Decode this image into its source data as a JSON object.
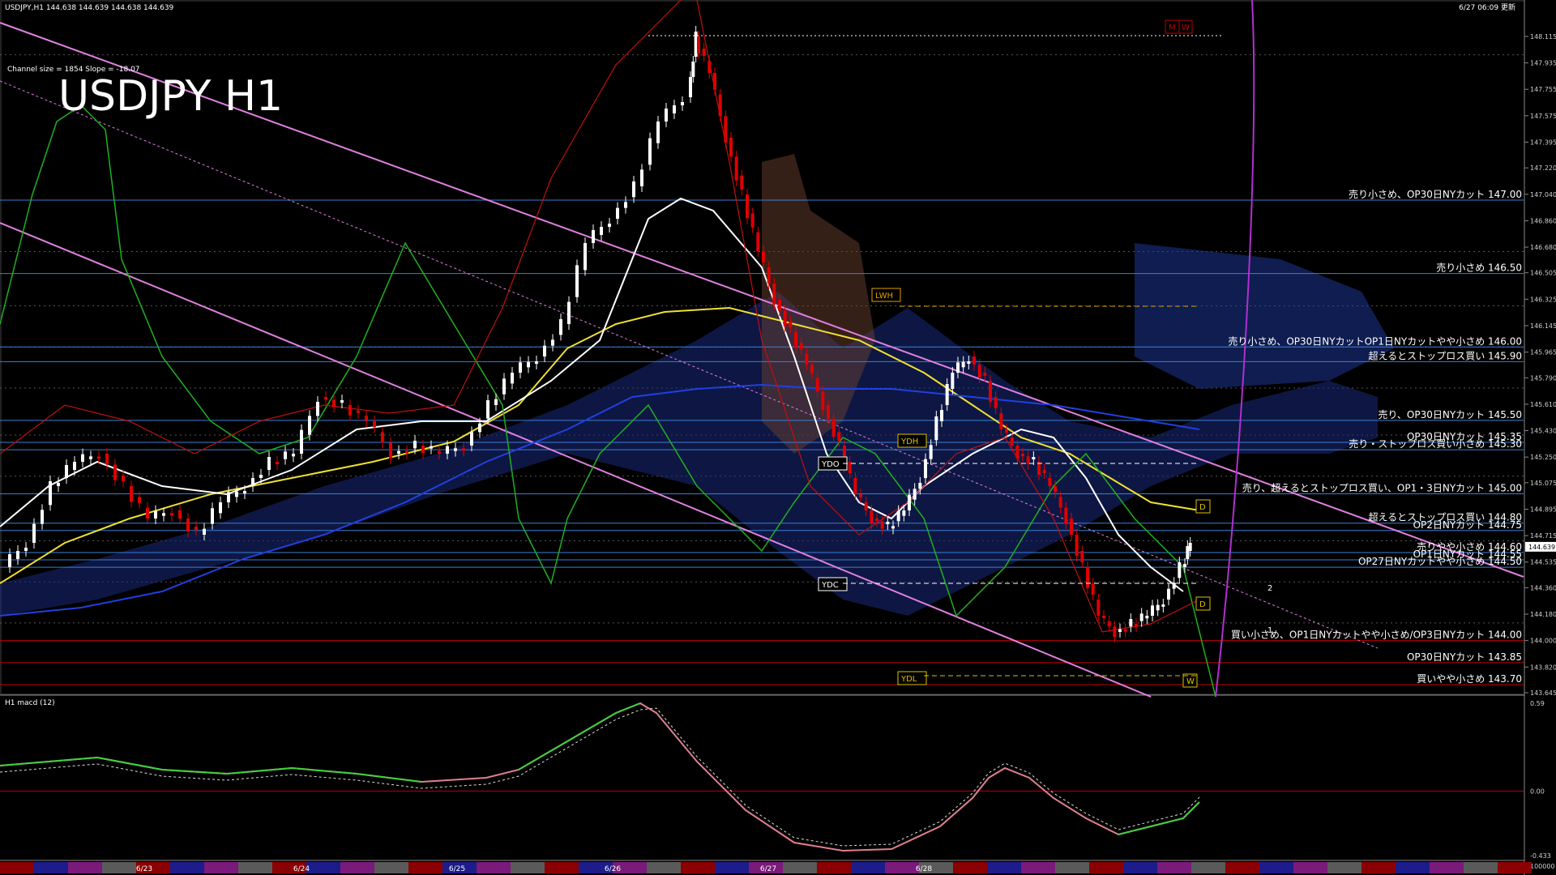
{
  "header": {
    "symbol_info": "USDJPY,H1  144.638 144.639 144.638 144.639",
    "datetime": "6/27 06:09 更新",
    "channel_info": "Channel size = 1854 Slope = -18.07"
  },
  "chart_data": {
    "type": "candlestick",
    "title": "USDJPY H1",
    "ylim": [
      143.645,
      148.115
    ],
    "y_ticks": [
      148.115,
      147.935,
      147.755,
      147.575,
      147.395,
      147.22,
      147.04,
      146.86,
      146.68,
      146.505,
      146.325,
      146.145,
      145.965,
      145.79,
      145.61,
      145.43,
      145.25,
      145.075,
      144.895,
      144.715,
      144.535,
      144.36,
      144.18,
      144.0,
      143.82,
      143.645
    ],
    "current_price": "144.639",
    "x_labels": [
      "6/23",
      "6/24",
      "6/25",
      "6/26",
      "6/27",
      "6/28"
    ],
    "level_lines": [
      {
        "label": "売り小さめ、OP30日NYカット 147.00",
        "value": 147.0,
        "color": "#3a7fd5"
      },
      {
        "label": "売り小さめ 146.50",
        "value": 146.5,
        "color": "#3a7fd5"
      },
      {
        "label": "売り小さめ、OP30日NYカットOP1日NYカットやや小さめ 146.00",
        "value": 146.0,
        "color": "#3a7fd5"
      },
      {
        "label": "超えるとストップロス買い 145.90",
        "value": 145.9,
        "color": "#3a7fd5"
      },
      {
        "label": "売り、OP30日NYカット 145.50",
        "value": 145.5,
        "color": "#3a7fd5"
      },
      {
        "label": "OP30日NYカット 145.35",
        "value": 145.35,
        "color": "#3a7fd5"
      },
      {
        "label": "売り・ストップロス買い小さめ 145.30",
        "value": 145.3,
        "color": "#3a7fd5"
      },
      {
        "label": "売り、超えるとストップロス買い、OP1・3日NYカット 145.00",
        "value": 145.0,
        "color": "#3a7fd5"
      },
      {
        "label": "超えるとストップロス買い 144.80",
        "value": 144.8,
        "color": "#3a7fd5"
      },
      {
        "label": "OP2日NYカット 144.75",
        "value": 144.75,
        "color": "#3a7fd5"
      },
      {
        "label": "売りやや小さめ 144.60",
        "value": 144.6,
        "color": "#3a7fd5"
      },
      {
        "label": "OP1日NYカット 144.55",
        "value": 144.55,
        "color": "#3a7fd5"
      },
      {
        "label": "OP27日NYカットやや小さめ 144.50",
        "value": 144.5,
        "color": "#3a7fd5"
      },
      {
        "label": "買い小さめ、OP1日NYカットやや小さめ/OP3日NYカット 144.00",
        "value": 144.0,
        "color": "#c00000"
      },
      {
        "label": "OP30日NYカット 143.85",
        "value": 143.85,
        "color": "#c00000"
      },
      {
        "label": "買いやや小さめ 143.70",
        "value": 143.7,
        "color": "#c00000"
      }
    ],
    "markers": [
      "YDO",
      "YDC",
      "YDH",
      "YDL",
      "LWH",
      "D",
      "D",
      "W",
      "M",
      "W",
      "2",
      "1"
    ],
    "indicator": {
      "name": "H1  macd (12)",
      "ylim": [
        -0.433,
        0.59
      ],
      "y_ticks": [
        0.59,
        0.0,
        -0.433
      ],
      "bottom_tick": "100000"
    }
  },
  "colors": {
    "background": "#000000",
    "bull": "#ffffff",
    "bear": "#e00000",
    "level_blue": "#3a7fd5",
    "level_red": "#c00000",
    "channel": "#e080e0",
    "sma_white": "#ffffff",
    "sma_yellow": "#f0e030",
    "sma_blue": "#2040e0",
    "macd": "#40d040",
    "macd_neg": "#e08090"
  }
}
